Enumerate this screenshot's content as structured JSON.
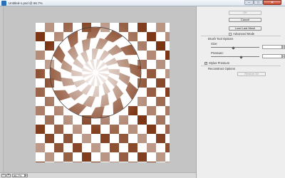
{
  "window": {
    "title": "Untitled-1.psd @ 66.7%",
    "minimize_glyph": "–",
    "maximize_glyph": "□",
    "close_glyph": "✕"
  },
  "status": {
    "zoom_out": "–",
    "zoom_in": "+",
    "zoom_value": "66.7%",
    "zoom_arrow": "▸"
  },
  "panel": {
    "ok_label": "OK",
    "cancel_label": "Cancel",
    "load_mesh_label": "Load Last Mesh",
    "advanced_mode_label": "Advanced Mode",
    "advanced_mode_checked": false,
    "brush_tool_options_label": "Brush Tool Options",
    "size_label": "Size:",
    "size_value": "",
    "size_level": 0.47,
    "pressure_label": "Pressure:",
    "pressure_value": "",
    "pressure_level": 0.62,
    "stylus_pressure_label": "Stylus Pressure",
    "stylus_pressure_checked": true,
    "reconstruct_options_label": "Reconstruct Options",
    "restore_all_label": "Restore All"
  },
  "canvas": {
    "pattern": "warped-checkerboard",
    "dark_color": "#7a3412",
    "light_color": "#ffffff",
    "brush_cursor": "circle-outline"
  }
}
